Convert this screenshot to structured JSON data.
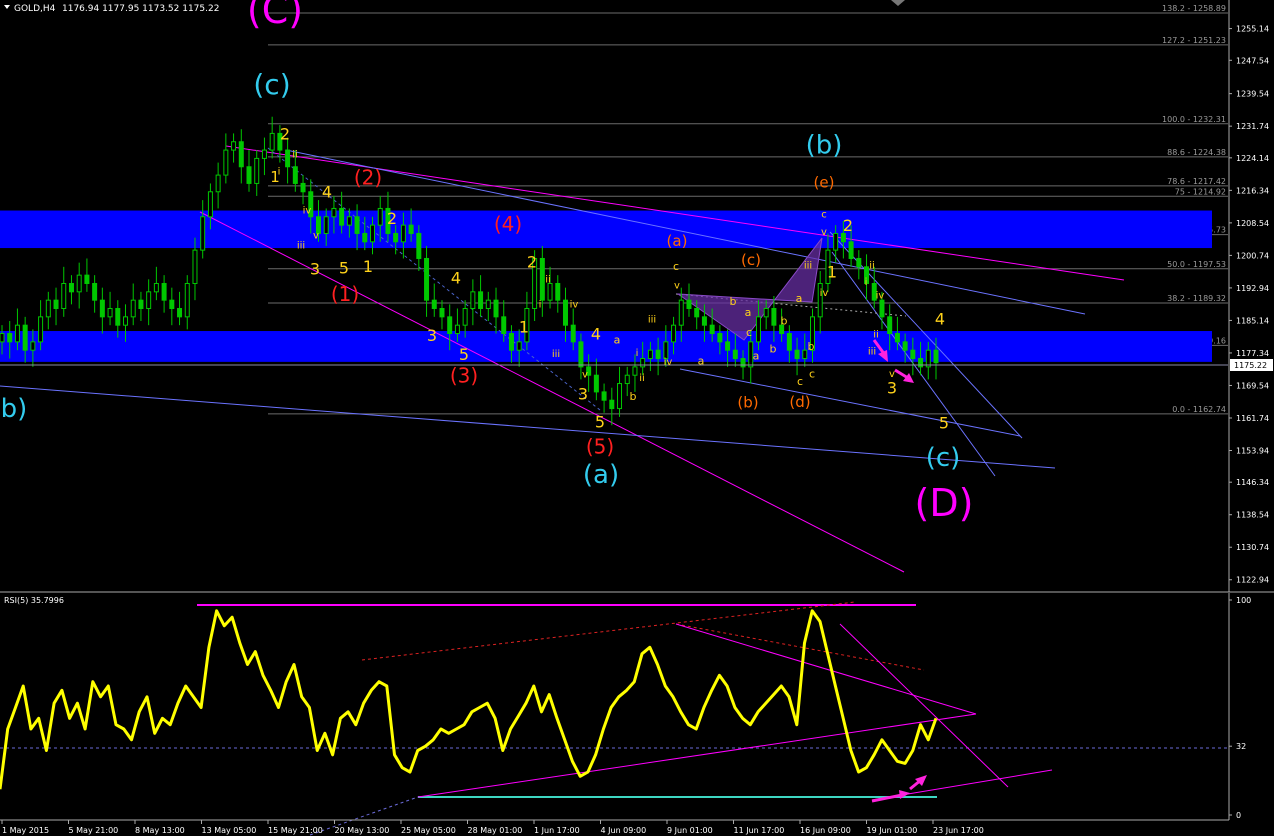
{
  "header": {
    "symbol": "GOLD,H4",
    "ohlc": "1176.94 1177.95 1173.52 1175.22"
  },
  "rsi_label": "RSI(5) 35.7996",
  "current_price": "1175.22",
  "colors": {
    "background": "#000000",
    "candle": "#00c800",
    "zone": "#0000ff",
    "pink": "#ff00ff",
    "cyan": "#33ccee",
    "red": "#ff2020",
    "orange": "#ff6a00",
    "yellow": "#ffd21a",
    "rsi": "#ffff00",
    "teal": "#3dd6c2",
    "trend_blue": "#6b73ff"
  },
  "chart_data": [
    {
      "type": "line",
      "title": "GOLD,H4",
      "ylim": [
        1120.0,
        1262.0
      ],
      "price_ticks": [
        "1255.14",
        "1247.54",
        "1239.54",
        "1231.74",
        "1224.14",
        "1216.34",
        "1208.54",
        "1200.74",
        "1192.94",
        "1185.14",
        "1177.34",
        "1169.54",
        "1161.74",
        "1153.94",
        "1146.34",
        "1138.54",
        "1130.74",
        "1122.94"
      ],
      "time_labels": [
        "1 May 2015",
        "5 May 21:00",
        "8 May 13:00",
        "13 May 05:00",
        "15 May 21:00",
        "20 May 13:00",
        "25 May 05:00",
        "28 May 01:00",
        "1 Jun 17:00",
        "4 Jun 09:00",
        "9 Jun 01:00",
        "11 Jun 17:00",
        "16 Jun 09:00",
        "19 Jun 01:00",
        "23 Jun 17:00"
      ],
      "fib_levels": [
        {
          "label": "138.2 - 1258.89",
          "price": 1258.89
        },
        {
          "label": "127.2 - 1251.23",
          "price": 1251.23
        },
        {
          "label": "100.0 - 1232.31",
          "price": 1232.31
        },
        {
          "label": "88.6 - 1224.38",
          "price": 1224.38
        },
        {
          "label": "78.6 - 1217.42",
          "price": 1217.42
        },
        {
          "label": "75 - 1214.92",
          "price": 1214.92
        },
        {
          "label": "61.8 - 1205.73",
          "price": 1205.73
        },
        {
          "label": "50.0 - 1197.53",
          "price": 1197.53
        },
        {
          "label": "38.2 - 1189.32",
          "price": 1189.32
        },
        {
          "label": "23.6 - 1179.16",
          "price": 1179.16
        },
        {
          "label": "0.0 - 1162.74",
          "price": 1162.74
        }
      ],
      "zones": [
        [
          1202.5,
          1211.5
        ],
        [
          1175.2,
          1182.6
        ]
      ],
      "closes": [
        1182,
        1180,
        1184,
        1178,
        1180,
        1186,
        1190,
        1188,
        1194,
        1192,
        1196,
        1194,
        1190,
        1186,
        1188,
        1184,
        1186,
        1190,
        1188,
        1192,
        1194,
        1190,
        1188,
        1186,
        1194,
        1202,
        1210,
        1216,
        1220,
        1226,
        1228,
        1222,
        1218,
        1224,
        1226,
        1230,
        1226,
        1222,
        1218,
        1216,
        1210,
        1206,
        1210,
        1212,
        1208,
        1210,
        1206,
        1204,
        1208,
        1212,
        1206,
        1204,
        1208,
        1206,
        1200,
        1190,
        1188,
        1186,
        1182,
        1184,
        1188,
        1192,
        1188,
        1190,
        1186,
        1182,
        1178,
        1180,
        1188,
        1200,
        1190,
        1194,
        1190,
        1184,
        1180,
        1174,
        1172,
        1168,
        1166,
        1164,
        1170,
        1172,
        1174,
        1176,
        1178,
        1176,
        1180,
        1184,
        1190,
        1188,
        1186,
        1184,
        1182,
        1180,
        1178,
        1176,
        1174,
        1180,
        1186,
        1188,
        1184,
        1182,
        1178,
        1176,
        1178,
        1186,
        1194,
        1202,
        1206,
        1204,
        1200,
        1198,
        1194,
        1190,
        1186,
        1182,
        1180,
        1178,
        1176,
        1174,
        1178,
        1175
      ],
      "wave_labels": [
        {
          "text": "(C)",
          "price": 1256.5,
          "color": "pink",
          "size": 38
        },
        {
          "text": "(c)",
          "price": 1239.5,
          "color": "cyan",
          "size": 28
        },
        {
          "text": "b)",
          "price": 1162.0,
          "color": "cyan",
          "size": 26
        },
        {
          "text": "(2)",
          "price": 1217.8,
          "color": "red",
          "size": 20
        },
        {
          "text": "(1)",
          "price": 1189.8,
          "color": "red",
          "size": 20
        },
        {
          "text": "(3)",
          "price": 1170.2,
          "color": "red",
          "size": 20
        },
        {
          "text": "(4)",
          "price": 1206.6,
          "color": "red",
          "size": 20
        },
        {
          "text": "(5)",
          "price": 1153.2,
          "color": "red",
          "size": 20
        },
        {
          "text": "(a)",
          "price": 1146.2,
          "color": "cyan",
          "size": 26
        },
        {
          "text": "(b)",
          "price": 1225.2,
          "color": "cyan",
          "size": 26
        },
        {
          "text": "(c)",
          "price": 1150.2,
          "color": "cyan",
          "size": 26
        },
        {
          "text": "(D)",
          "price": 1138.2,
          "color": "pink",
          "size": 38
        },
        {
          "text": "(a)",
          "price": 1203.0,
          "color": "orange",
          "size": 15
        },
        {
          "text": "(c)",
          "price": 1198.4,
          "color": "orange",
          "size": 15
        },
        {
          "text": "(e)",
          "price": 1217.0,
          "color": "orange",
          "size": 15
        },
        {
          "text": "(b)",
          "price": 1164.2,
          "color": "orange",
          "size": 15
        },
        {
          "text": "(d)",
          "price": 1164.4,
          "color": "orange",
          "size": 15
        },
        {
          "text": "2",
          "price": 1228.5,
          "color": "yellow",
          "size": 16
        },
        {
          "text": "1",
          "price": 1218.4,
          "color": "yellow",
          "size": 15
        },
        {
          "text": "4",
          "price": 1214.6,
          "color": "yellow",
          "size": 16
        },
        {
          "text": "3",
          "price": 1196.2,
          "color": "yellow",
          "size": 16
        },
        {
          "text": "5",
          "price": 1196.4,
          "color": "yellow",
          "size": 16
        },
        {
          "text": "1",
          "price": 1196.8,
          "color": "yellow",
          "size": 16
        },
        {
          "text": "2",
          "price": 1208.3,
          "color": "yellow",
          "size": 16
        },
        {
          "text": "4",
          "price": 1194.0,
          "color": "yellow",
          "size": 16
        },
        {
          "text": "3",
          "price": 1180.2,
          "color": "yellow",
          "size": 16
        },
        {
          "text": "5",
          "price": 1175.6,
          "color": "yellow",
          "size": 16
        },
        {
          "text": "1",
          "price": 1182.2,
          "color": "yellow",
          "size": 16
        },
        {
          "text": "2",
          "price": 1197.8,
          "color": "yellow",
          "size": 16
        },
        {
          "text": "4",
          "price": 1180.6,
          "color": "yellow",
          "size": 16
        },
        {
          "text": "3",
          "price": 1166.2,
          "color": "yellow",
          "size": 16
        },
        {
          "text": "5",
          "price": 1159.4,
          "color": "yellow",
          "size": 16
        },
        {
          "text": "2",
          "price": 1206.6,
          "color": "yellow",
          "size": 16
        },
        {
          "text": "1",
          "price": 1195.4,
          "color": "yellow",
          "size": 16
        },
        {
          "text": "3",
          "price": 1167.6,
          "color": "yellow",
          "size": 16
        },
        {
          "text": "4",
          "price": 1184.2,
          "color": "yellow",
          "size": 16
        },
        {
          "text": "5",
          "price": 1159.2,
          "color": "yellow",
          "size": 16
        },
        {
          "text": "ii",
          "price": 1224.2,
          "color": "yellow",
          "size": 10
        },
        {
          "text": "i",
          "price": 1220.2,
          "color": "yellow",
          "size": 10
        },
        {
          "text": "iv",
          "price": 1210.8,
          "color": "yellow",
          "size": 10
        },
        {
          "text": "iii",
          "price": 1202.4,
          "color": "yellow",
          "size": 10
        },
        {
          "text": "v",
          "price": 1204.8,
          "color": "yellow",
          "size": 10
        },
        {
          "text": "ii",
          "price": 1194.2,
          "color": "yellow",
          "size": 10
        },
        {
          "text": "i",
          "price": 1188.2,
          "color": "yellow",
          "size": 10
        },
        {
          "text": "iv",
          "price": 1188.2,
          "color": "yellow",
          "size": 10
        },
        {
          "text": "iii",
          "price": 1176.4,
          "color": "yellow",
          "size": 10
        },
        {
          "text": "v",
          "price": 1171.4,
          "color": "yellow",
          "size": 10
        },
        {
          "text": "iii",
          "price": 1184.6,
          "color": "yellow",
          "size": 10
        },
        {
          "text": "i",
          "price": 1176.6,
          "color": "yellow",
          "size": 10
        },
        {
          "text": "ii",
          "price": 1170.6,
          "color": "yellow",
          "size": 10
        },
        {
          "text": "iv",
          "price": 1174.4,
          "color": "yellow",
          "size": 10
        },
        {
          "text": "v",
          "price": 1192.8,
          "color": "yellow",
          "size": 10
        },
        {
          "text": "c",
          "price": 1197.2,
          "color": "yellow",
          "size": 11
        },
        {
          "text": "a",
          "price": 1179.6,
          "color": "yellow",
          "size": 11
        },
        {
          "text": "b",
          "price": 1166.0,
          "color": "yellow",
          "size": 11
        },
        {
          "text": "a",
          "price": 1174.6,
          "color": "yellow",
          "size": 11
        },
        {
          "text": "b",
          "price": 1188.8,
          "color": "yellow",
          "size": 11
        },
        {
          "text": "a",
          "price": 1186.2,
          "color": "yellow",
          "size": 11
        },
        {
          "text": "c",
          "price": 1181.4,
          "color": "yellow",
          "size": 11
        },
        {
          "text": "b",
          "price": 1177.4,
          "color": "yellow",
          "size": 11
        },
        {
          "text": "c",
          "price": 1169.6,
          "color": "yellow",
          "size": 11
        },
        {
          "text": "a",
          "price": 1175.8,
          "color": "yellow",
          "size": 11
        },
        {
          "text": "b",
          "price": 1184.2,
          "color": "yellow",
          "size": 11
        },
        {
          "text": "c",
          "price": 1171.4,
          "color": "yellow",
          "size": 11
        },
        {
          "text": "a",
          "price": 1189.6,
          "color": "yellow",
          "size": 11
        },
        {
          "text": "b",
          "price": 1178.0,
          "color": "yellow",
          "size": 11
        },
        {
          "text": "c",
          "price": 1209.8,
          "color": "yellow",
          "size": 10
        },
        {
          "text": "v",
          "price": 1205.6,
          "color": "yellow",
          "size": 10
        },
        {
          "text": "iii",
          "price": 1197.6,
          "color": "yellow",
          "size": 10
        },
        {
          "text": "iv",
          "price": 1191.0,
          "color": "yellow",
          "size": 10
        },
        {
          "text": "ii",
          "price": 1181.0,
          "color": "yellow",
          "size": 10
        },
        {
          "text": "ii",
          "price": 1197.6,
          "color": "yellow",
          "size": 10
        },
        {
          "text": "i",
          "price": 1193.6,
          "color": "yellow",
          "size": 10
        },
        {
          "text": "iv",
          "price": 1190.4,
          "color": "yellow",
          "size": 10
        },
        {
          "text": "iii",
          "price": 1177.0,
          "color": "yellow",
          "size": 10
        },
        {
          "text": "v",
          "price": 1171.6,
          "color": "yellow",
          "size": 10
        }
      ]
    },
    {
      "type": "line",
      "title": "RSI(5) 35.7996",
      "ylim": [
        0,
        100
      ],
      "ticks": [
        "100",
        "32",
        "0"
      ],
      "values": [
        12,
        40,
        50,
        60,
        40,
        45,
        30,
        52,
        58,
        45,
        52,
        40,
        62,
        55,
        60,
        42,
        40,
        35,
        48,
        55,
        38,
        45,
        42,
        52,
        60,
        55,
        50,
        78,
        95,
        88,
        92,
        80,
        70,
        76,
        65,
        58,
        50,
        62,
        70,
        55,
        50,
        30,
        38,
        28,
        45,
        48,
        42,
        52,
        58,
        62,
        60,
        28,
        22,
        20,
        30,
        32,
        35,
        40,
        38,
        40,
        42,
        48,
        50,
        52,
        45,
        30,
        40,
        46,
        52,
        60,
        48,
        56,
        45,
        35,
        25,
        18,
        20,
        28,
        40,
        50,
        55,
        58,
        62,
        75,
        78,
        70,
        60,
        55,
        48,
        42,
        40,
        50,
        58,
        65,
        60,
        50,
        45,
        42,
        48,
        52,
        56,
        60,
        55,
        42,
        80,
        95,
        90,
        75,
        60,
        45,
        30,
        20,
        22,
        28,
        35,
        30,
        25,
        24,
        30,
        42,
        35,
        45
      ]
    }
  ]
}
